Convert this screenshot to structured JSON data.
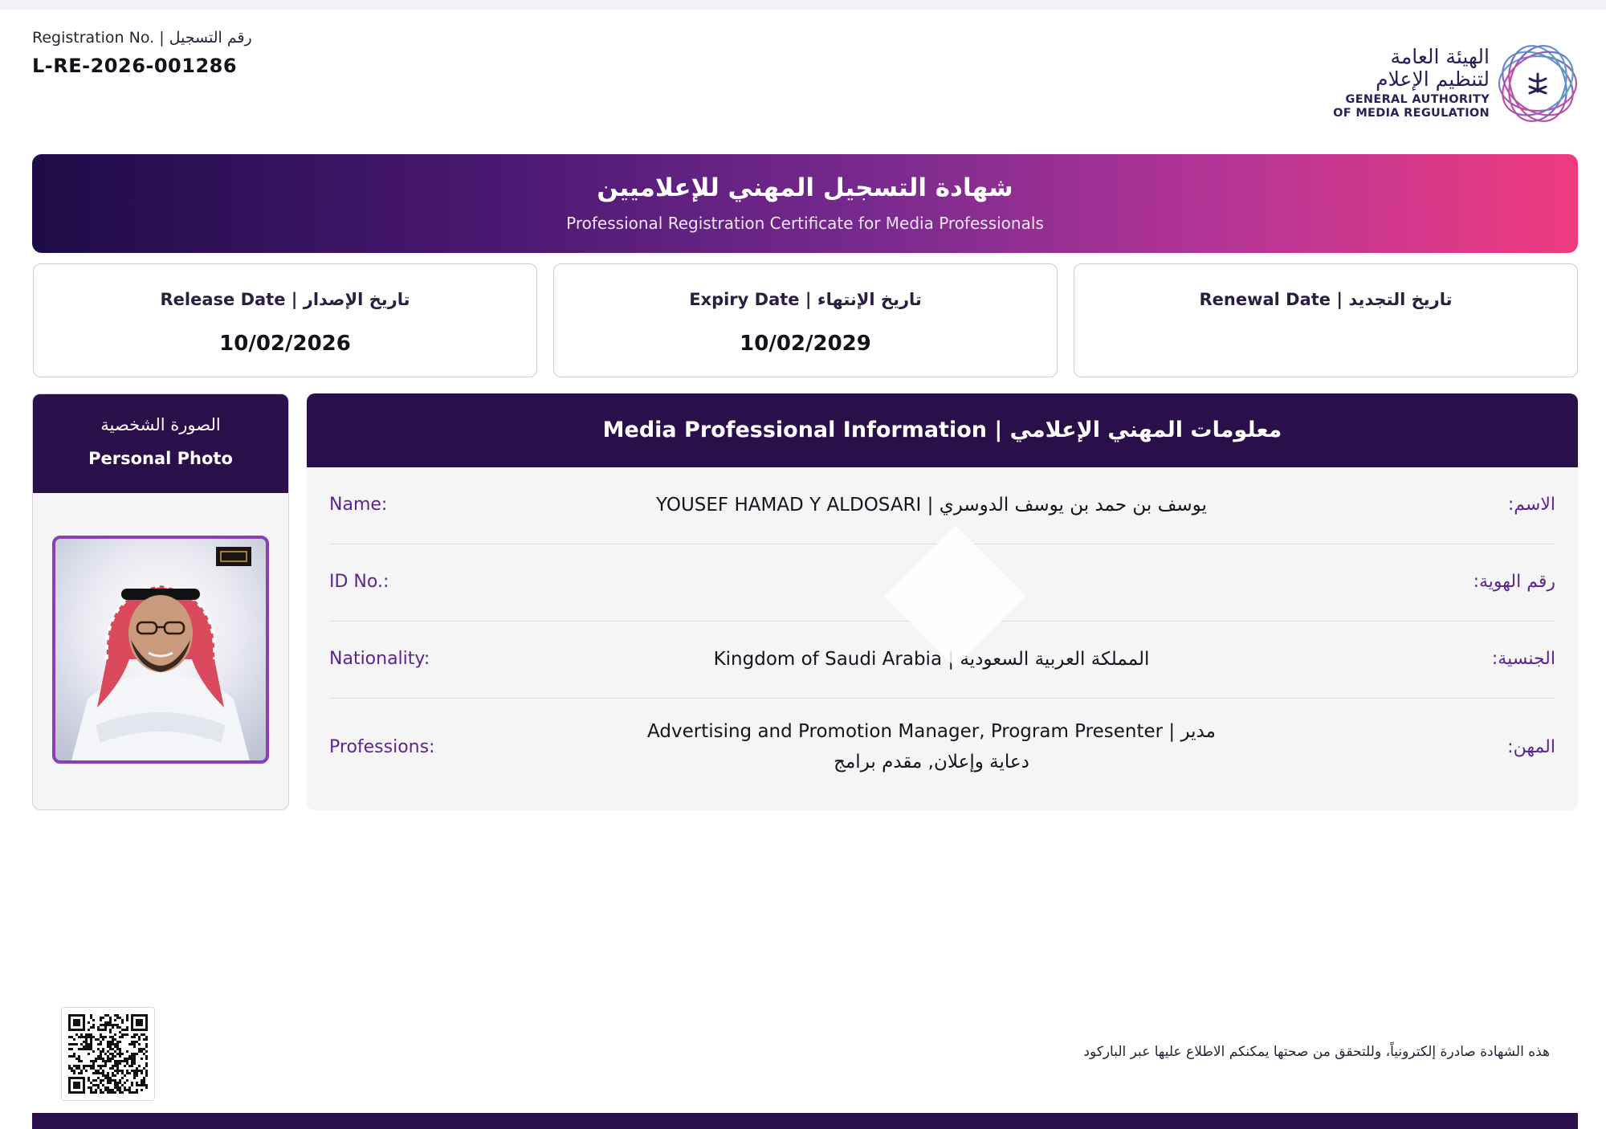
{
  "header": {
    "registration_label": "Registration No. | رقم التسجيل",
    "registration_number": "L-RE-2026-001286"
  },
  "logo": {
    "arabic_line1": "الهيئة العامة",
    "arabic_line2": "لتنظيم الإعلام",
    "english_line1": "GENERAL AUTHORITY",
    "english_line2": "OF MEDIA REGULATION"
  },
  "banner": {
    "title_ar": "شهادة التسجيل المهني للإعلاميين",
    "title_en": "Professional Registration Certificate for Media Professionals"
  },
  "dates": {
    "release": {
      "label": "Release Date | تاريخ الإصدار",
      "value": "10/02/2026"
    },
    "expiry": {
      "label": "Expiry Date | تاريخ الإنتهاء",
      "value": "10/02/2029"
    },
    "renewal": {
      "label": "Renewal Date | تاريخ التجديد",
      "value": ""
    }
  },
  "photo_panel": {
    "title_ar": "الصورة الشخصية",
    "title_en": "Personal Photo"
  },
  "info": {
    "heading": "Media Professional Information | معلومات المهني الإعلامي",
    "rows": [
      {
        "label_en": "Name:",
        "label_ar": "الاسم:",
        "value": "YOUSEF HAMAD Y ALDOSARI | يوسف بن حمد بن يوسف الدوسري"
      },
      {
        "label_en": "ID No.:",
        "label_ar": "رقم الهوية:",
        "value": ""
      },
      {
        "label_en": "Nationality:",
        "label_ar": "الجنسية:",
        "value": "Kingdom of Saudi Arabia | المملكة العربية السعودية"
      },
      {
        "label_en": "Professions:",
        "label_ar": "المهن:",
        "value": "Advertising and Promotion Manager, Program Presenter | مدير دعاية وإعلان, مقدم برامج"
      }
    ]
  },
  "footer": {
    "note": "هذه الشهادة صادرة إلكترونياً، وللتحقق من صحتها يمكنكم الاطلاع عليها عبر الباركود"
  },
  "colors": {
    "primary_dark": "#2a0f4a",
    "accent_purple": "#5b2590",
    "gradient_start": "#1d0c47",
    "gradient_end": "#ef3b7e"
  }
}
